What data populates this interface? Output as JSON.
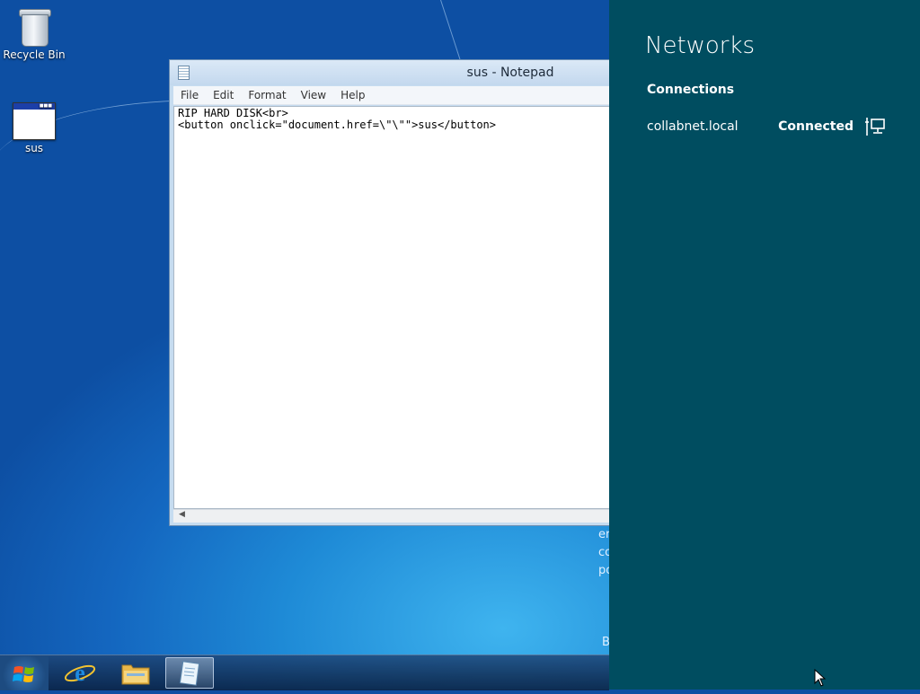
{
  "desktop": {
    "icons": [
      {
        "label": "Recycle Bin",
        "icon": "recycle-bin-icon"
      },
      {
        "label": "sus",
        "icon": "html-file-icon"
      }
    ]
  },
  "notepad": {
    "title": "sus - Notepad",
    "menu": [
      "File",
      "Edit",
      "Format",
      "View",
      "Help"
    ],
    "content": "RIP HARD DISK<br>\n<button onclick=\"document.href=\\\"\\\"\">sus</button>"
  },
  "networks_panel": {
    "title": "Networks",
    "section": "Connections",
    "connection": {
      "name": "collabnet.local",
      "status": "Connected",
      "icon": "wired-network-icon"
    },
    "background": "#004d60"
  },
  "taskbar": {
    "items": [
      {
        "name": "start-button",
        "icon": "windows-logo-icon"
      },
      {
        "name": "internet-explorer",
        "icon": "ie-icon"
      },
      {
        "name": "file-explorer",
        "icon": "folder-icon"
      },
      {
        "name": "notepad",
        "icon": "notepad-icon",
        "active": true
      }
    ]
  },
  "background_peek": {
    "lines": [
      "er",
      "co",
      "po"
    ],
    "letter": "B"
  }
}
